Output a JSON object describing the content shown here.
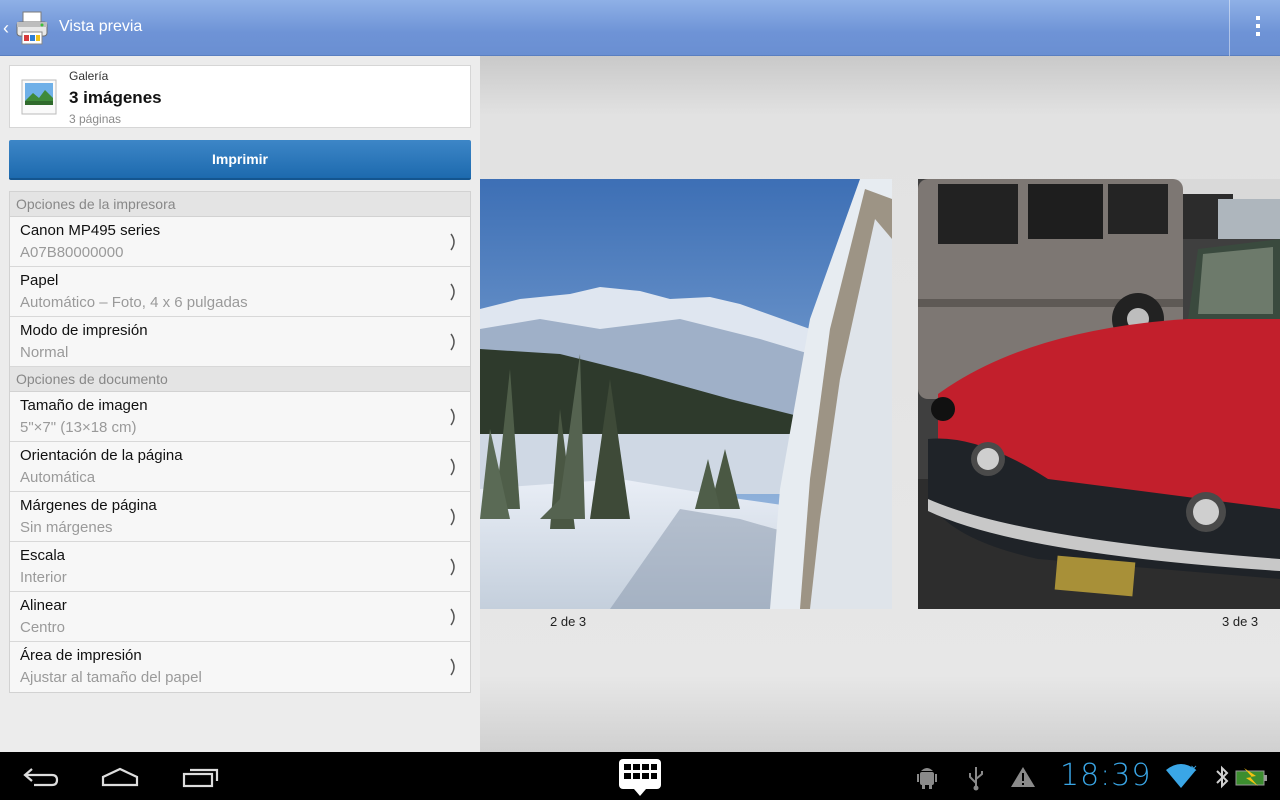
{
  "action_bar": {
    "title": "Vista previa",
    "up_icon": "chevron-left-icon",
    "app_icon": "printer-app-icon",
    "overflow_icon": "overflow-menu-icon"
  },
  "source": {
    "caption": "Galería",
    "title": "3 imágenes",
    "subtitle": "3 páginas",
    "icon": "gallery-image-icon"
  },
  "print_button": {
    "label": "Imprimir"
  },
  "printer_section": {
    "header": "Opciones de la impresora",
    "rows": [
      {
        "label": "Canon MP495 series",
        "value": "A07B80000000"
      },
      {
        "label": "Papel",
        "value": "Automático – Foto, 4 x 6 pulgadas"
      },
      {
        "label": "Modo de impresión",
        "value": "Normal"
      }
    ]
  },
  "document_section": {
    "header": "Opciones de documento",
    "rows": [
      {
        "label": "Tamaño de imagen",
        "value": "5\"×7\" (13×18 cm)"
      },
      {
        "label": "Orientación de la página",
        "value": "Automática"
      },
      {
        "label": "Márgenes de página",
        "value": "Sin márgenes"
      },
      {
        "label": "Escala",
        "value": "Interior"
      },
      {
        "label": "Alinear",
        "value": "Centro"
      },
      {
        "label": "Área de impresión",
        "value": "Ajustar al tamaño del papel"
      }
    ]
  },
  "preview": {
    "pages": [
      {
        "label": "2 de 3",
        "subject": "winter-landscape-photo",
        "selected": true
      },
      {
        "label": "3 de 3",
        "subject": "red-car-photo",
        "selected": false
      }
    ]
  },
  "system_bar": {
    "clock": "18:39",
    "accent": "#3aa6e6",
    "left_icons": [
      "back-icon",
      "home-icon",
      "recent-apps-icon"
    ],
    "center_icon": "keyboard-icon",
    "status_icons": [
      "android-debug-icon",
      "usb-icon",
      "warning-icon",
      "wifi-icon",
      "bluetooth-icon",
      "battery-icon"
    ]
  }
}
